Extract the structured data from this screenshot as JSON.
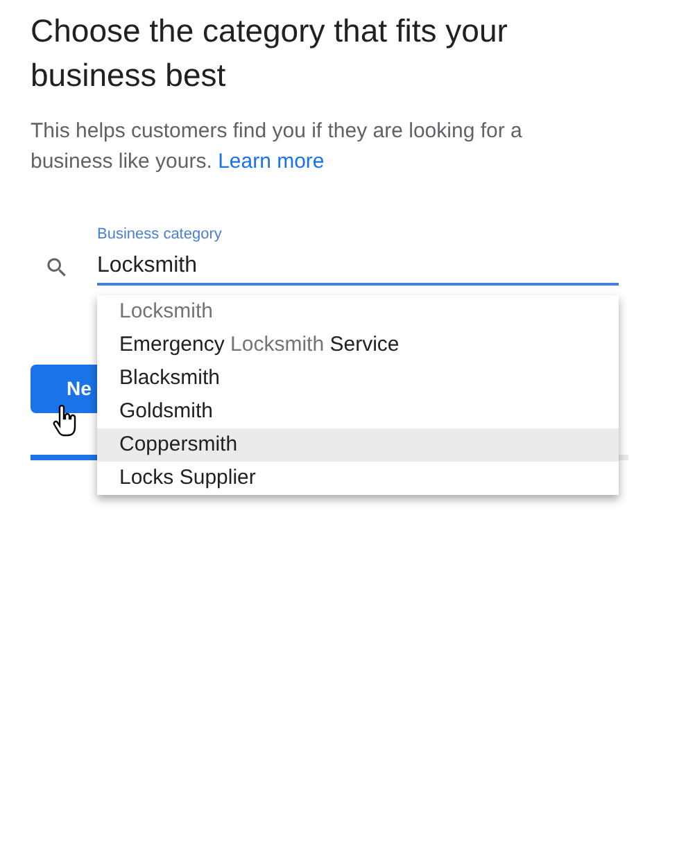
{
  "heading": "Choose the category that fits your business best",
  "description": {
    "text": "This helps customers find you if they are looking for a business like yours.",
    "link": "Learn more"
  },
  "field": {
    "label": "Business category",
    "value": "Locksmith",
    "focused": true
  },
  "suggestions": [
    {
      "parts": [
        {
          "text": "Locksmith",
          "match": true
        }
      ],
      "selected": false
    },
    {
      "parts": [
        {
          "text": "Emergency ",
          "match": false
        },
        {
          "text": "Locksmith",
          "match": true
        },
        {
          "text": " Service",
          "match": false
        }
      ],
      "selected": false
    },
    {
      "parts": [
        {
          "text": "Blacksmith",
          "match": false
        }
      ],
      "selected": false
    },
    {
      "parts": [
        {
          "text": "Goldsmith",
          "match": false
        }
      ],
      "selected": false
    },
    {
      "parts": [
        {
          "text": "Coppersmith",
          "match": false
        }
      ],
      "selected": true
    },
    {
      "parts": [
        {
          "text": "Locks Supplier",
          "match": false
        }
      ],
      "selected": false
    }
  ],
  "next_button": {
    "label": "Ne"
  },
  "progress": {
    "level": 0.12
  }
}
